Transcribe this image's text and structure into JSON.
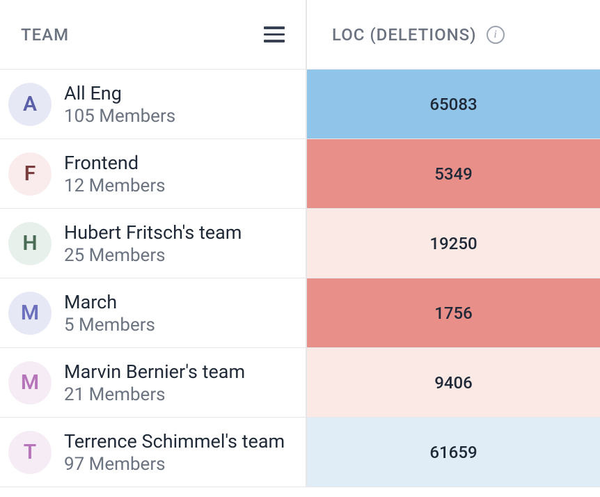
{
  "header": {
    "team_label": "TEAM",
    "loc_label": "LOC (DELETIONS)"
  },
  "rows": [
    {
      "initial": "A",
      "name": "All Eng",
      "members": "105 Members",
      "loc": "65083",
      "avatar_bg": "#e7e8f6",
      "avatar_fg": "#5a5fa8",
      "loc_bg": "#90c5e9"
    },
    {
      "initial": "F",
      "name": "Frontend",
      "members": "12 Members",
      "loc": "5349",
      "avatar_bg": "#faecec",
      "avatar_fg": "#7a3d3d",
      "loc_bg": "#e98f8a"
    },
    {
      "initial": "H",
      "name": "Hubert Fritsch's team",
      "members": "25 Members",
      "loc": "19250",
      "avatar_bg": "#e7f0ea",
      "avatar_fg": "#4a6b56",
      "loc_bg": "#fbe9e6"
    },
    {
      "initial": "M",
      "name": "March",
      "members": "5 Members",
      "loc": "1756",
      "avatar_bg": "#e7e8f6",
      "avatar_fg": "#6c70bd",
      "loc_bg": "#e98f8a"
    },
    {
      "initial": "M",
      "name": "Marvin Bernier's team",
      "members": "21 Members",
      "loc": "9406",
      "avatar_bg": "#f5ecf5",
      "avatar_fg": "#b675b8",
      "loc_bg": "#fbe9e6"
    },
    {
      "initial": "T",
      "name": "Terrence Schimmel's team",
      "members": "97 Members",
      "loc": "61659",
      "avatar_bg": "#f5ecf5",
      "avatar_fg": "#b675b8",
      "loc_bg": "#e1edf6"
    }
  ]
}
